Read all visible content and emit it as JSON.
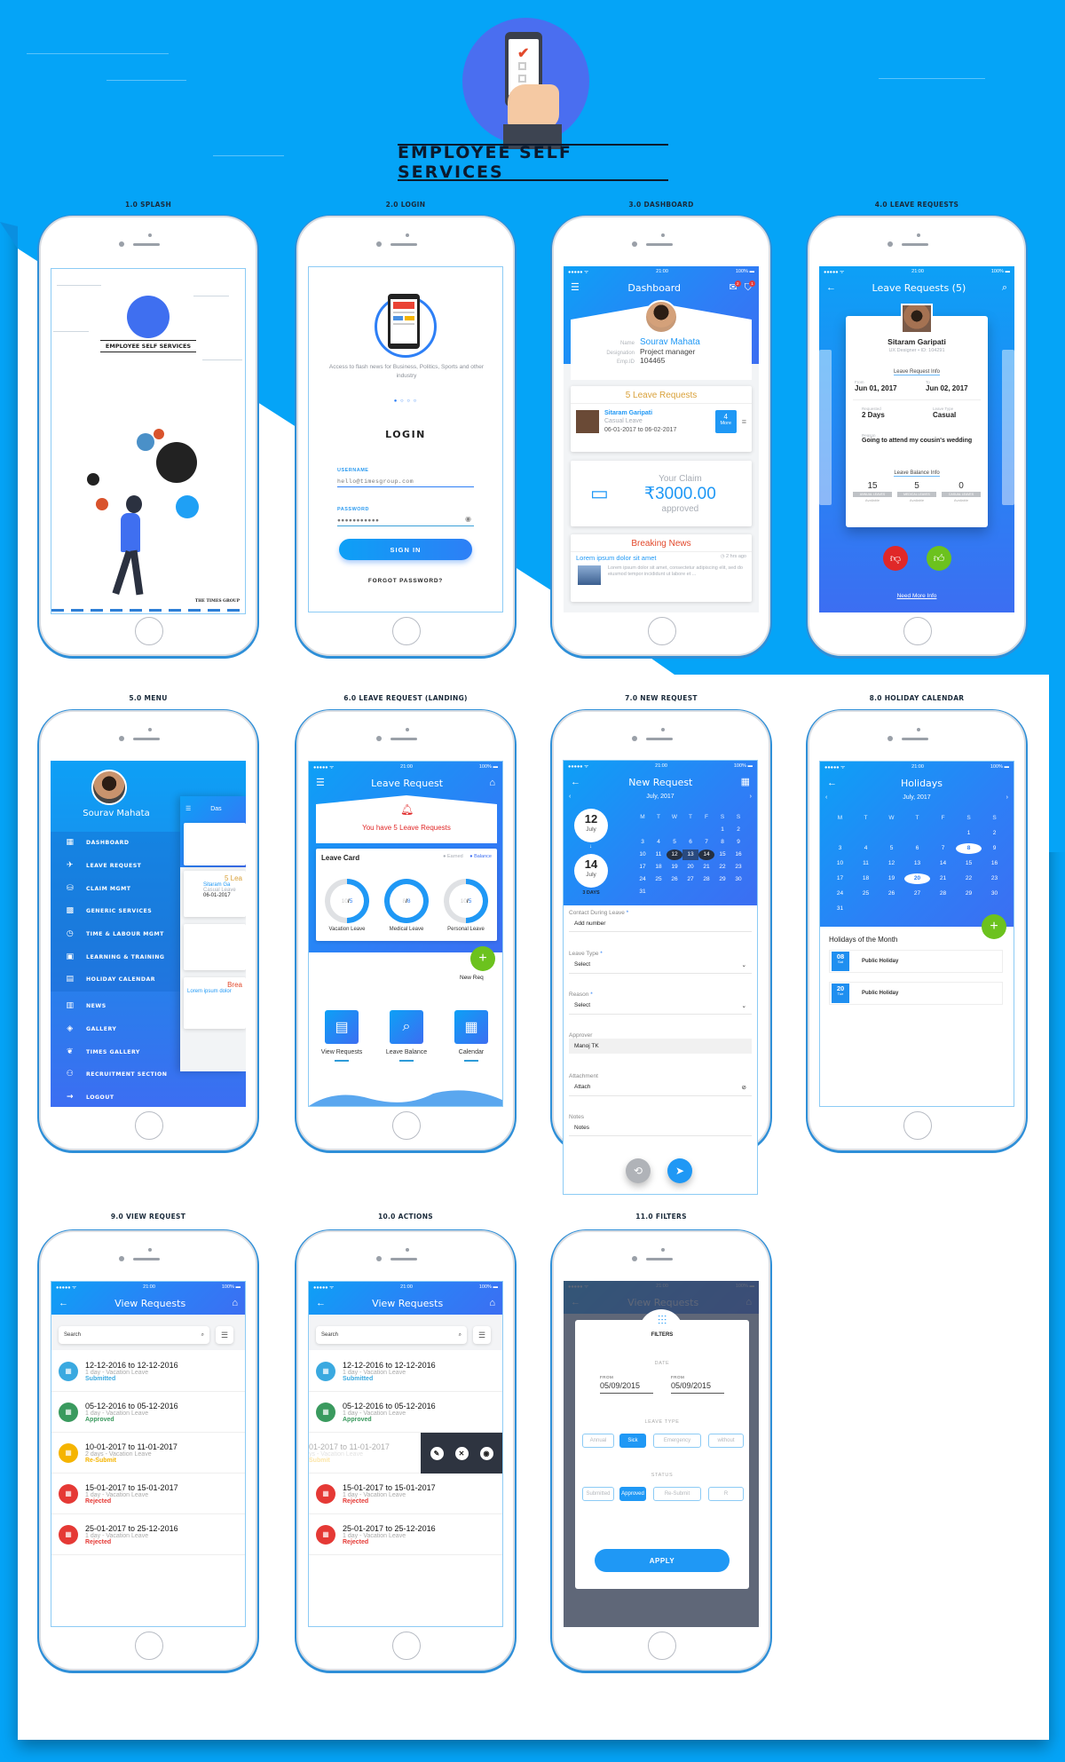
{
  "hero": {
    "title": "EMPLOYEE SELF SERVICES",
    "icon": "phone-checklist-icon"
  },
  "screens": {
    "s1": {
      "label": "1.0 SPLASH",
      "logo_title": "EMPLOYEE SELF SERVICES",
      "brand": "THE TIMES GROUP"
    },
    "s2": {
      "label": "2.0 LOGIN",
      "carousel_text": "Access to flash news for Business, Politics, Sports and other industry",
      "carousel_dots": "● ○ ○ ○",
      "heading": "LOGIN",
      "username_label": "USERNAME",
      "username_value": "hello@timesgroup.com",
      "password_label": "PASSWORD",
      "password_value": "●●●●●●●●●●●",
      "signin": "SIGN IN",
      "forgot": "FORGOT PASSWORD?"
    },
    "s3": {
      "label": "3.0 DASHBOARD",
      "status": {
        "carrier": "●●●●● ᯤ",
        "time": "21:00",
        "battery": "100% ▬"
      },
      "title": "Dashboard",
      "mail_badge": "2",
      "alert_badge": "1",
      "profile": {
        "name_key": "Name",
        "name": "Sourav Mahata",
        "designation_key": "Designation",
        "designation": "Project manager",
        "emp_key": "Emp.ID",
        "emp": "104465"
      },
      "leave": {
        "title": "5 Leave Requests",
        "name": "Sitaram Garipati",
        "type": "Casual Leave",
        "dates": "06-01-2017 to 06-02-2017",
        "more_count": "4",
        "more_label": "More"
      },
      "claim": {
        "title": "Your Claim",
        "amount": "₹3000.00",
        "status": "approved"
      },
      "news": {
        "title": "Breaking News",
        "headline": "Lorem ipsum dolor sit amet",
        "time": "◷ 2 hrs ago",
        "body": "Lorem ipsum dolor sit amet, consectetur adipiscing elit, sed do eiusmod tempor incididunt ut labore et ..."
      }
    },
    "s4": {
      "label": "4.0 LEAVE REQUESTS",
      "title": "Leave Requests (5)",
      "name": "Sitaram Garipati",
      "role": "UX Designer  •  ID: 104291",
      "info_title": "Leave Request Info",
      "from_label": "From",
      "from": "Jun 01, 2017",
      "to_label": "To",
      "to": "Jun 02, 2017",
      "requested_label": "Requested",
      "requested": "2 Days",
      "type_label": "Leave Type",
      "type": "Casual",
      "reason_label": "Reason",
      "reason": "Going to attend my cousin's wedding",
      "balance_title": "Leave Balance Info",
      "balances": [
        {
          "value": "15",
          "tag": "ANNUAL LEAVES",
          "sub": "Available"
        },
        {
          "value": "5",
          "tag": "MEDICAL LEAVES",
          "sub": "Available"
        },
        {
          "value": "0",
          "tag": "CASUAL LEAVES",
          "sub": "Available"
        }
      ],
      "more_info": "Need More Info"
    },
    "s5": {
      "label": "5.0 MENU",
      "user": "Sourav Mahata",
      "items": [
        {
          "label": "DASHBOARD",
          "icon": "▦"
        },
        {
          "label": "LEAVE REQUEST",
          "icon": "✈"
        },
        {
          "label": "CLAIM MGMT",
          "icon": "⛁"
        },
        {
          "label": "GENERIC SERVICES",
          "icon": "▩"
        },
        {
          "label": "TIME & LABOUR MGMT",
          "icon": "◷"
        },
        {
          "label": "LEARNING & TRAINING",
          "icon": "▣"
        },
        {
          "label": "HOLIDAY CALENDAR",
          "icon": "▤"
        }
      ],
      "items2": [
        {
          "label": "NEWS",
          "icon": "▥"
        },
        {
          "label": "GALLERY",
          "icon": "◈"
        },
        {
          "label": "TIMES GALLERY",
          "icon": "❦"
        },
        {
          "label": "RECRUITMENT SECTION",
          "icon": "⚇"
        },
        {
          "label": "LOGOUT",
          "icon": "→"
        }
      ],
      "peek": {
        "title": "Das",
        "leave": "5 Lea",
        "name": "Sitaram Ga",
        "type": "Casual Leave",
        "date": "06-01-2017",
        "news": "Brea",
        "headline": "Lorem ipsum dolor"
      }
    },
    "s6": {
      "label": "6.0 LEAVE REQUEST (LANDING)",
      "title": "Leave Request",
      "alert": "You have 5 Leave Requests",
      "card_title": "Leave Card",
      "legend_earned": "Earned",
      "legend_balance": "Balance",
      "donuts": [
        {
          "label": "Vacation Leave",
          "earned": "10",
          "balance": "5",
          "fraction": 0.5
        },
        {
          "label": "Medical Leave",
          "earned": "8",
          "balance": "8",
          "fraction": 1.0
        },
        {
          "label": "Personal Leave",
          "earned": "10",
          "balance": "5",
          "fraction": 0.5
        }
      ],
      "new_req": "New Req",
      "tiles": [
        {
          "label": "View Requests",
          "icon": "▤"
        },
        {
          "label": "Leave Balance",
          "icon": "⌕"
        },
        {
          "label": "Calendar",
          "icon": "▦"
        }
      ]
    },
    "s7": {
      "label": "7.0 NEW REQUEST",
      "title": "New Request",
      "month": "July, 2017",
      "from_day": "12",
      "from_month": "July",
      "to_day": "14",
      "to_month": "July",
      "days": "3 DAYS",
      "weekdays": [
        "M",
        "T",
        "W",
        "T",
        "F",
        "S",
        "S"
      ],
      "fields": [
        {
          "label": "Contact During Leave",
          "required": true,
          "value": "Add number"
        },
        {
          "label": "Leave Type",
          "required": true,
          "value": "Select"
        },
        {
          "label": "Reason",
          "required": true,
          "value": "Select"
        },
        {
          "label": "Approver",
          "required": false,
          "value": "Manoj TK"
        },
        {
          "label": "Attachment",
          "required": false,
          "value": "Attach"
        },
        {
          "label": "Notes",
          "required": false,
          "value": "Notes"
        }
      ]
    },
    "s8": {
      "label": "8.0 HOLIDAY CALENDAR",
      "title": "Holidays",
      "month": "July, 2017",
      "weekdays": [
        "M",
        "T",
        "W",
        "T",
        "F",
        "S",
        "S"
      ],
      "highlighted": [
        "8",
        "20"
      ],
      "list_title": "Holidays of the Month",
      "holidays": [
        {
          "day": "08",
          "dow": "Sat",
          "name": "Public Holiday"
        },
        {
          "day": "20",
          "dow": "Tue",
          "name": "Public Holiday"
        }
      ]
    },
    "s9": {
      "label": "9.0 VIEW REQUEST",
      "title": "View Requests",
      "search_placeholder": "Search"
    },
    "s10": {
      "label": "10.0 ACTIONS",
      "title": "View Requests",
      "search_placeholder": "Search",
      "swiped_partial": {
        "a": "01-2017 to 11-01-2017",
        "b": "ys - Vacation Leave",
        "c": "Submit"
      }
    },
    "s11": {
      "label": "11.0 FILTERS",
      "title": "View Requests",
      "heading": "FILTERS",
      "date_section": "DATE",
      "from1_label": "FROM",
      "from1": "05/09/2015",
      "from2_label": "FROM",
      "from2": "05/09/2015",
      "type_section": "LEAVE TYPE",
      "types": [
        {
          "label": "Annual",
          "on": false
        },
        {
          "label": "Sick",
          "on": true
        },
        {
          "label": "Emergency",
          "on": false
        },
        {
          "label": "without",
          "on": false
        }
      ],
      "status_section": "STATUS",
      "statuses": [
        {
          "label": "Submitted",
          "on": false
        },
        {
          "label": "Approved",
          "on": true
        },
        {
          "label": "Re-Submit",
          "on": false
        },
        {
          "label": "R",
          "on": false
        }
      ],
      "apply": "APPLY"
    }
  },
  "requests": [
    {
      "range": "12-12-2016 to 12-12-2016",
      "detail": "1 day - Vacation Leave",
      "status": "Submitted",
      "color": "#3aa9e0"
    },
    {
      "range": "05-12-2016 to 05-12-2016",
      "detail": "1 day - Vacation Leave",
      "status": "Approved",
      "color": "#3a9a5e"
    },
    {
      "range": "10-01-2017 to 11-01-2017",
      "detail": "2 days - Vacation Leave",
      "status": "Re-Submit",
      "color": "#f5b400"
    },
    {
      "range": "15-01-2017 to 15-01-2017",
      "detail": "1 day - Vacation Leave",
      "status": "Rejected",
      "color": "#e53935"
    },
    {
      "range": "25-01-2017 to 25-12-2016",
      "detail": "1 day - Vacation Leave",
      "status": "Rejected",
      "color": "#e53935"
    }
  ],
  "colors": {
    "brand_blue": "#05a4f7",
    "accent": "#2d7ff6",
    "green": "#6cc21e",
    "red": "#e02828",
    "orange": "#d9a13a"
  }
}
